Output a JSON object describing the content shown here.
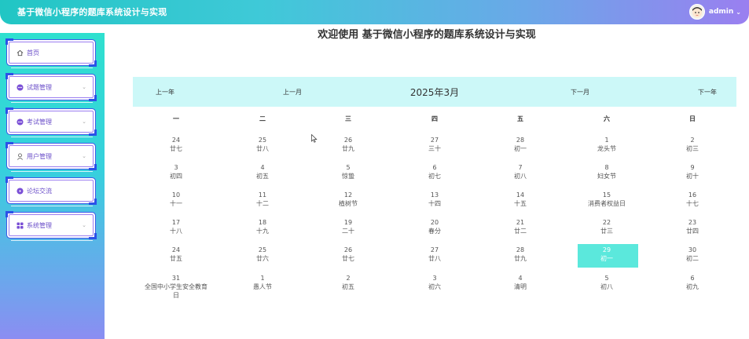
{
  "app": {
    "title": "基于微信小程序的题库系统设计与实现",
    "user": "admin"
  },
  "sidebar": {
    "items": [
      {
        "label": "首页",
        "icon": "home-icon"
      },
      {
        "label": "试题管理",
        "icon": "dots-circle-icon"
      },
      {
        "label": "考试管理",
        "icon": "dots-circle-icon"
      },
      {
        "label": "用户管理",
        "icon": "user-icon"
      },
      {
        "label": "论坛交流",
        "icon": "dot-circle-icon"
      },
      {
        "label": "系统管理",
        "icon": "grid-icon"
      }
    ]
  },
  "main": {
    "title": "欢迎使用 基于微信小程序的题库系统设计与实现"
  },
  "calendar": {
    "prev_year": "上一年",
    "prev_month": "上一月",
    "month_title": "2025年3月",
    "next_month": "下一月",
    "next_year": "下一年",
    "weekdays": [
      "一",
      "二",
      "三",
      "四",
      "五",
      "六",
      "日"
    ],
    "weeks": [
      [
        {
          "num": "24",
          "lunar": "廿七"
        },
        {
          "num": "25",
          "lunar": "廿八"
        },
        {
          "num": "26",
          "lunar": "廿九"
        },
        {
          "num": "27",
          "lunar": "三十"
        },
        {
          "num": "28",
          "lunar": "初一"
        },
        {
          "num": "1",
          "lunar": "龙头节"
        },
        {
          "num": "2",
          "lunar": "初三"
        }
      ],
      [
        {
          "num": "3",
          "lunar": "初四"
        },
        {
          "num": "4",
          "lunar": "初五"
        },
        {
          "num": "5",
          "lunar": "惊蛰"
        },
        {
          "num": "6",
          "lunar": "初七"
        },
        {
          "num": "7",
          "lunar": "初八"
        },
        {
          "num": "8",
          "lunar": "妇女节"
        },
        {
          "num": "9",
          "lunar": "初十"
        }
      ],
      [
        {
          "num": "10",
          "lunar": "十一"
        },
        {
          "num": "11",
          "lunar": "十二"
        },
        {
          "num": "12",
          "lunar": "植树节"
        },
        {
          "num": "13",
          "lunar": "十四"
        },
        {
          "num": "14",
          "lunar": "十五"
        },
        {
          "num": "15",
          "lunar": "消费者权益日"
        },
        {
          "num": "16",
          "lunar": "十七"
        }
      ],
      [
        {
          "num": "17",
          "lunar": "十八"
        },
        {
          "num": "18",
          "lunar": "十九"
        },
        {
          "num": "19",
          "lunar": "二十"
        },
        {
          "num": "20",
          "lunar": "春分"
        },
        {
          "num": "21",
          "lunar": "廿二"
        },
        {
          "num": "22",
          "lunar": "廿三"
        },
        {
          "num": "23",
          "lunar": "廿四"
        }
      ],
      [
        {
          "num": "24",
          "lunar": "廿五"
        },
        {
          "num": "25",
          "lunar": "廿六"
        },
        {
          "num": "26",
          "lunar": "廿七"
        },
        {
          "num": "27",
          "lunar": "廿八"
        },
        {
          "num": "28",
          "lunar": "廿九"
        },
        {
          "num": "29",
          "lunar": "初一",
          "today": true
        },
        {
          "num": "30",
          "lunar": "初二"
        }
      ],
      [
        {
          "num": "31",
          "lunar": "全国中小学生安全教育日"
        },
        {
          "num": "1",
          "lunar": "愚人节"
        },
        {
          "num": "2",
          "lunar": "初五"
        },
        {
          "num": "3",
          "lunar": "初六"
        },
        {
          "num": "4",
          "lunar": "清明"
        },
        {
          "num": "5",
          "lunar": "初八"
        },
        {
          "num": "6",
          "lunar": "初九"
        }
      ]
    ]
  },
  "colors": {
    "accent": "#5be8dc",
    "header_bg": "#ccf8f8",
    "menu_border": "#3f5be8"
  }
}
